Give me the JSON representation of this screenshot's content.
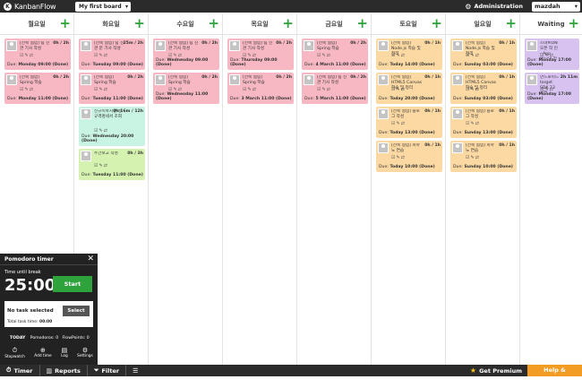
{
  "topbar": {
    "logo_text": "KanbanFlow",
    "board_select": "My first board",
    "admin_label": "Administration",
    "user_label": "mazdah"
  },
  "columns": [
    {
      "name": "월요일",
      "tasks": [
        {
          "color": "pink",
          "title": "[전북 협업] 팀 신관 기사 작성",
          "time": "0h / 2h",
          "due_label": "Due:",
          "due": "Monday 09:00 (Done)"
        },
        {
          "color": "pink",
          "title": "[전북 협업] Spring 학습",
          "time": "0h / 2h",
          "due_label": "Due:",
          "due": "Monday 11:00 (Done)"
        }
      ]
    },
    {
      "name": "화요일",
      "tasks": [
        {
          "color": "pink",
          "title": "[전북 협업] 팀 신관 문 기사 작성",
          "time": "25m / 2h",
          "due_label": "Due:",
          "due": "Tuesday 09:00 (Done)"
        },
        {
          "color": "pink",
          "title": "[전북 협업] Spring 학습",
          "time": "0h / 2h",
          "due_label": "Due:",
          "due": "Tuesday 11:00 (Done)"
        },
        {
          "color": "green",
          "tall": true,
          "title": "신규이북지면 동 - 규격명세서 조회",
          "time": "0h 16m / 12h",
          "due_label": "Due:",
          "due": "Wednesday 20:00 (Done)"
        },
        {
          "color": "lime",
          "title": "주간보고 작성",
          "time": "0h / 3h",
          "due_label": "Due:",
          "due": "Tuesday 11:00 (Done)"
        }
      ]
    },
    {
      "name": "수요일",
      "tasks": [
        {
          "color": "pink",
          "title": "[전북 협업] 팀 신관 기사 작성",
          "time": "0h / 2h",
          "due_label": "Due:",
          "due": "Wednesday 09:00 (Done)"
        },
        {
          "color": "pink",
          "title": "[전북 협업] Spring 학습",
          "time": "0h / 2h",
          "due_label": "Due:",
          "due": "Wednesday 11:00 (Done)"
        }
      ]
    },
    {
      "name": "목요일",
      "tasks": [
        {
          "color": "pink",
          "title": "[전북 협업] 팀 신관 기사 작성",
          "time": "0h / 2h",
          "due_label": "Due:",
          "due": "Thursday 09:00 (Done)"
        },
        {
          "color": "pink",
          "title": "[전북 협업] Spring 학습",
          "time": "0h / 2h",
          "due_label": "Due:",
          "due": "3 March 11:00 (Done)"
        }
      ]
    },
    {
      "name": "금요일",
      "tasks": [
        {
          "color": "pink",
          "title": "[전북 협업] Spring 학습",
          "time": "0h / 2h",
          "due_label": "Due:",
          "due": "4 March 11:00 (Done)"
        },
        {
          "color": "pink",
          "title": "[전북 협업] 팀 신관 기사 작성",
          "time": "0h / 2h",
          "due_label": "Due:",
          "due": "5 March 11:00 (Done)"
        }
      ]
    },
    {
      "name": "토요일",
      "tasks": [
        {
          "color": "yellow",
          "title": "[전북 협업] Node.js 학습 및 정리",
          "time": "0h / 1h",
          "due_label": "Due:",
          "due": "Today 14:00 (Done)"
        },
        {
          "color": "yellow",
          "title": "[전북 협업] HTML5 Canvas 학습 및 정리",
          "time": "0h / 1h",
          "due_label": "Due:",
          "due": "Today 20:00 (Done)"
        },
        {
          "color": "yellow",
          "title": "[전북 협업] 블로그 작성",
          "time": "0h / 1h",
          "due_label": "Due:",
          "due": "Today 13:00 (Done)"
        },
        {
          "color": "yellow",
          "title": "[전북 협업] 피아노 연습",
          "time": "0h / 1h",
          "due_label": "Due:",
          "due": "Today 10:00 (Done)"
        }
      ]
    },
    {
      "name": "일요일",
      "tasks": [
        {
          "color": "yellow",
          "title": "[전북 협업] Node.js 학습 및 정리",
          "time": "0h / 1h",
          "due_label": "Due:",
          "due": "Sunday 03:00 (Done)"
        },
        {
          "color": "yellow",
          "title": "[전북 협업] HTML5 Canvas 학습 및 정리",
          "time": "0h / 1h",
          "due_label": "Due:",
          "due": "Sunday 03:00 (Done)"
        },
        {
          "color": "yellow",
          "title": "[전북 협업] 블로그 작성",
          "time": "0h / 1h",
          "due_label": "Due:",
          "due": "Sunday 13:00 (Done)"
        },
        {
          "color": "yellow",
          "title": "[전북 협업] 피아노 연습",
          "time": "0h / 1h",
          "due_label": "Due:",
          "due": "Sunday 10:00 (Done)"
        }
      ]
    },
    {
      "name": "Waiting",
      "tasks": [
        {
          "color": "purple",
          "title": "스마트ON 오픈 작 인 - App World 진입 시 에서 정주하는 현상",
          "time": "",
          "due_label": "Due:",
          "due": "Monday 17:00 (Done)"
        },
        {
          "color": "purple",
          "title": "안드로이드 target SDK 23 설정",
          "time": "2h 11m",
          "due_label": "Due:",
          "due": "Monday 17:00 (Done)"
        }
      ]
    }
  ],
  "pomodoro": {
    "title": "Pomodoro timer",
    "close": "✕",
    "time_label": "Time until break",
    "time": "25:00",
    "start_label": "Start",
    "no_task": "No task selected",
    "select_label": "Select",
    "total_label": "Total task time:",
    "total_value": "00:00",
    "today_label": "TODAY",
    "pomodoros": "Pomodoros: 0",
    "flowpoints": "FlowPoints: 0",
    "tools": [
      {
        "icon": "stopwatch-icon",
        "glyph": "⏱",
        "label": "Stopwatch"
      },
      {
        "icon": "add-time-icon",
        "glyph": "⊕",
        "label": "Add time"
      },
      {
        "icon": "log-icon",
        "glyph": "▤",
        "label": "Log"
      },
      {
        "icon": "settings-icon",
        "glyph": "⚙",
        "label": "Settings"
      }
    ]
  },
  "bottombar": {
    "timer": "Timer",
    "reports": "Reports",
    "filter": "Filter",
    "premium": "Get Premium",
    "help": "Help & feedback"
  },
  "colors": {
    "pink": "#f7b8c3",
    "yellow": "#fcd9a3",
    "green": "#c9f3e2",
    "lime": "#d6f2b0",
    "purple": "#d8c2f0",
    "add_green": "#2ea23b",
    "help_orange": "#f39c24"
  }
}
